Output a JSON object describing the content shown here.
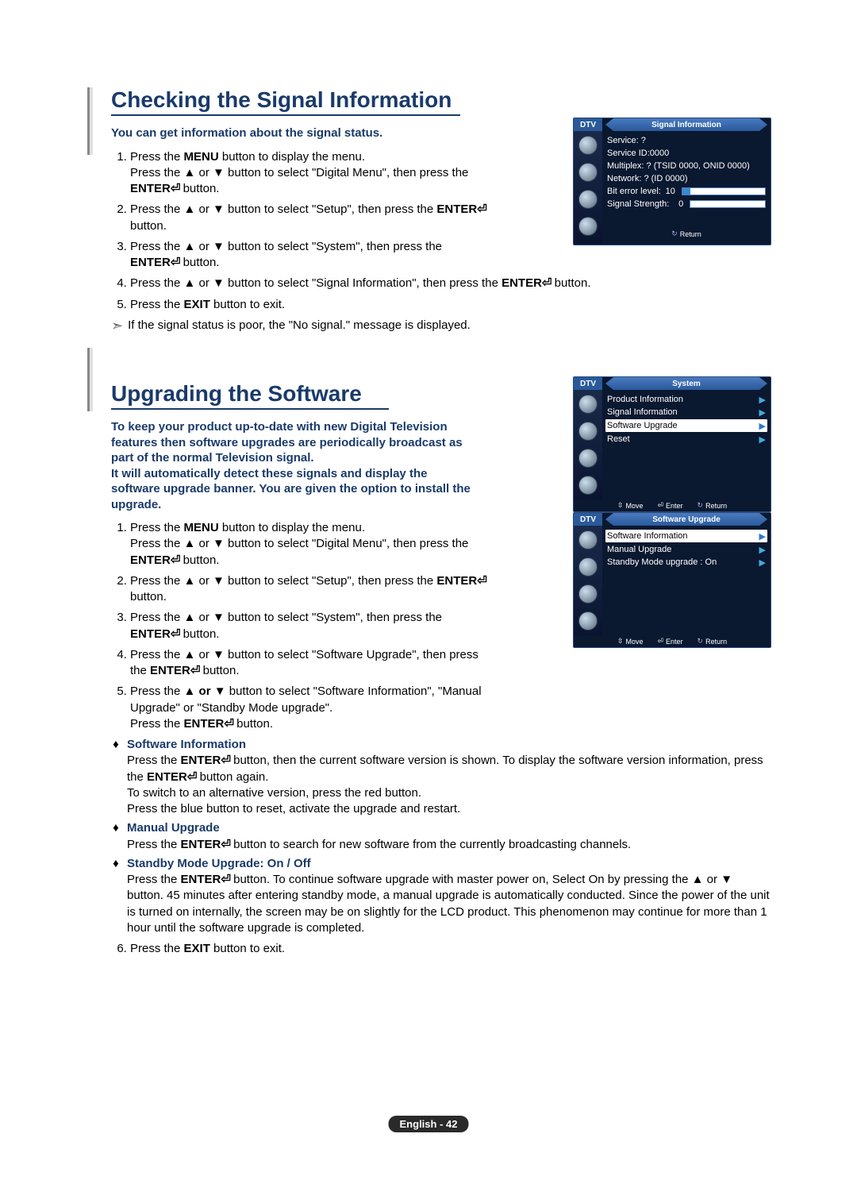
{
  "section1": {
    "title": "Checking the Signal Information",
    "intro": "You can get information about the signal status.",
    "steps": {
      "s1a": "Press the ",
      "s1b": "MENU",
      "s1c": " button to display the menu.",
      "s1d": "Press the ▲ or ▼ button to select \"Digital Menu\", then press the ",
      "s1e": "ENTER",
      "s1f": " button.",
      "s2a": "Press the ▲ or ▼ button to select \"Setup\", then press the ",
      "s2e": "ENTER",
      "s2f": " button.",
      "s3a": "Press the ▲ or ▼ button to select \"System\", then press the ",
      "s3e": "ENTER",
      "s3f": " button.",
      "s4a": "Press the ▲ or ▼ button to select \"Signal Information\", then press the ",
      "s4e": "ENTER",
      "s4f": " button.",
      "s5a": "Press the ",
      "s5b": "EXIT",
      "s5c": " button to exit."
    },
    "note": "If the signal status is poor, the \"No signal.\" message is displayed."
  },
  "section2": {
    "title": "Upgrading the Software",
    "intro1": "To keep your product up-to-date with new Digital Television features then software upgrades are periodically broadcast as part of the normal Television signal.",
    "intro2": "It will automatically detect these signals and display the software upgrade banner. You are given the option to install the upgrade.",
    "steps": {
      "s1a": "Press the ",
      "s1b": "MENU",
      "s1c": " button to display the menu.",
      "s1d": "Press the ▲ or ▼ button to select \"Digital Menu\", then press the ",
      "s1e": "ENTER",
      "s1f": " button.",
      "s2a": "Press the ▲ or ▼ button to select \"Setup\", then press the ",
      "s2e": "ENTER",
      "s2f": " button.",
      "s3a": "Press the ▲ or ▼ button to select \"System\", then press the ",
      "s3e": "ENTER",
      "s3f": " button.",
      "s4a": "Press the ▲ or ▼ button to select \"Software Upgrade\", then press the ",
      "s4e": "ENTER",
      "s4f": " button.",
      "s5a": "Press the ▲ ",
      "s5or": "or",
      "s5b": " ▼ button to select \"Software Information\", \"Manual Upgrade\" or \"Standby Mode upgrade\".",
      "s5c": "Press the ",
      "s5d": "ENTER",
      "s5e": " button."
    },
    "bullets": {
      "b1title": "Software Information",
      "b1l1a": "Press the ",
      "b1l1b": "ENTER",
      "b1l1c": " button, then the current software version is shown. To display the software version information, press the ",
      "b1l1d": "ENTER",
      "b1l1e": " button again.",
      "b1l2": "To switch to an alternative version, press the red button.",
      "b1l3": "Press the blue button to reset, activate the upgrade and restart.",
      "b2title": "Manual Upgrade",
      "b2l1a": "Press the ",
      "b2l1b": "ENTER",
      "b2l1c": " button to search for new software from the currently broadcasting channels.",
      "b3title": "Standby Mode Upgrade: On / Off",
      "b3l1a": "Press the ",
      "b3l1b": "ENTER",
      "b3l1c": " button. To continue software upgrade with master power on, Select On by pressing the ▲ or ▼ button. 45 minutes after entering standby mode, a manual upgrade is automatically conducted. Since the power of the unit is turned on internally, the screen may be on slightly for the LCD product. This phenomenon may continue for more than 1 hour until the software upgrade is completed."
    },
    "step6a": "Press the ",
    "step6b": "EXIT",
    "step6c": " button to exit."
  },
  "osd1": {
    "dtv": "DTV",
    "title": "Signal Information",
    "r1": "Service: ?",
    "r2": "Service ID:0000",
    "r3": "Multiplex: ? (TSID 0000, ONID 0000)",
    "r4": "Network: ? (ID 0000)",
    "r5l": "Bit error level:",
    "r5v": "10",
    "r6l": "Signal Strength:",
    "r6v": "0",
    "return": "Return"
  },
  "osd2": {
    "dtv": "DTV",
    "title": "System",
    "items": [
      "Product Information",
      "Signal Information",
      "Software Upgrade",
      "Reset"
    ],
    "move": "Move",
    "enter": "Enter",
    "return": "Return"
  },
  "osd3": {
    "dtv": "DTV",
    "title": "Software Upgrade",
    "items": [
      "Software Information",
      "Manual Upgrade",
      "Standby Mode upgrade : On"
    ],
    "move": "Move",
    "enter": "Enter",
    "return": "Return"
  },
  "footer": "English - 42"
}
